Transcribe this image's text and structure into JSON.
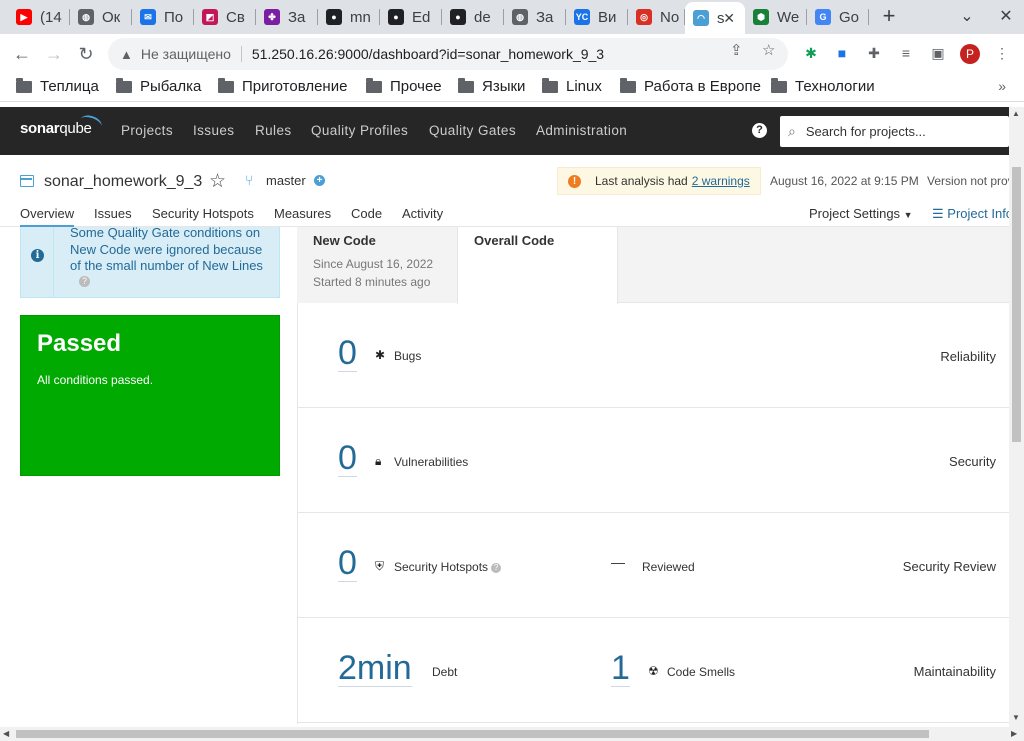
{
  "browser": {
    "tabs": [
      {
        "label": "(14",
        "color": "#ff0000",
        "glyph": "▶"
      },
      {
        "label": "Ок",
        "color": "#5f6368",
        "glyph": "◍"
      },
      {
        "label": "По",
        "color": "#1a73e8",
        "glyph": "✉"
      },
      {
        "label": "Св",
        "color": "#c2185b",
        "glyph": "◩"
      },
      {
        "label": "За",
        "color": "#7b1fa2",
        "glyph": "✤"
      },
      {
        "label": "mn",
        "color": "#202124",
        "glyph": "●"
      },
      {
        "label": "Ed",
        "color": "#202124",
        "glyph": "●"
      },
      {
        "label": "de",
        "color": "#202124",
        "glyph": "●"
      },
      {
        "label": "За",
        "color": "#5f6368",
        "glyph": "◍"
      },
      {
        "label": "Ви",
        "color": "#1a73e8",
        "glyph": "YC"
      },
      {
        "label": "No",
        "color": "#d93025",
        "glyph": "◎"
      },
      {
        "label": "s",
        "color": "#4b9fd5",
        "glyph": "◠",
        "active": true
      },
      {
        "label": "We",
        "color": "#188038",
        "glyph": "⬢"
      },
      {
        "label": "Go",
        "color": "#4285f4",
        "glyph": "G"
      }
    ],
    "not_secure": "Не защищено",
    "url": "51.250.16.26:9000/dashboard?id=sonar_homework_9_3",
    "profile_initial": "P",
    "bookmarks": [
      "Теплица",
      "Рыбалка",
      "Приготовление",
      "Прочее",
      "Языки",
      "Linux",
      "Работа в Европе",
      "Технологии"
    ],
    "bookmarks_more": "»"
  },
  "sonar_nav": {
    "logo_a": "sonar",
    "logo_b": "qube",
    "links": [
      "Projects",
      "Issues",
      "Rules",
      "Quality Profiles",
      "Quality Gates",
      "Administration"
    ],
    "help": "?",
    "search_placeholder": "Search for projects..."
  },
  "project": {
    "name": "sonar_homework_9_3",
    "branch": "master",
    "warning_prefix": "Last analysis had",
    "warning_link": "2 warnings",
    "analysis_date": "August 16, 2022 at 9:15 PM",
    "version": "Version not provided",
    "tabs": [
      "Overview",
      "Issues",
      "Security Hotspots",
      "Measures",
      "Code",
      "Activity"
    ],
    "settings": "Project Settings",
    "info": "Project Information"
  },
  "notice": {
    "text": "Some Quality Gate conditions on New Code were ignored because of the small number of New Lines"
  },
  "quality_gate": {
    "status": "Passed",
    "message": "All conditions passed.",
    "color": "#00aa00"
  },
  "measure_tabs": {
    "new_code": "New Code",
    "since": "Since August 16, 2022",
    "started": "Started 8 minutes ago",
    "overall": "Overall Code"
  },
  "measures": {
    "bugs_value": "0",
    "bugs_label": "Bugs",
    "reliability": "Reliability",
    "vuln_value": "0",
    "vuln_label": "Vulnerabilities",
    "security": "Security",
    "hotspots_value": "0",
    "hotspots_label": "Security Hotspots",
    "reviewed_value": "—",
    "reviewed_label": "Reviewed",
    "security_review": "Security Review",
    "debt_value": "2min",
    "debt_label": "Debt",
    "smells_value": "1",
    "smells_label": "Code Smells",
    "maintainability": "Maintainability"
  }
}
